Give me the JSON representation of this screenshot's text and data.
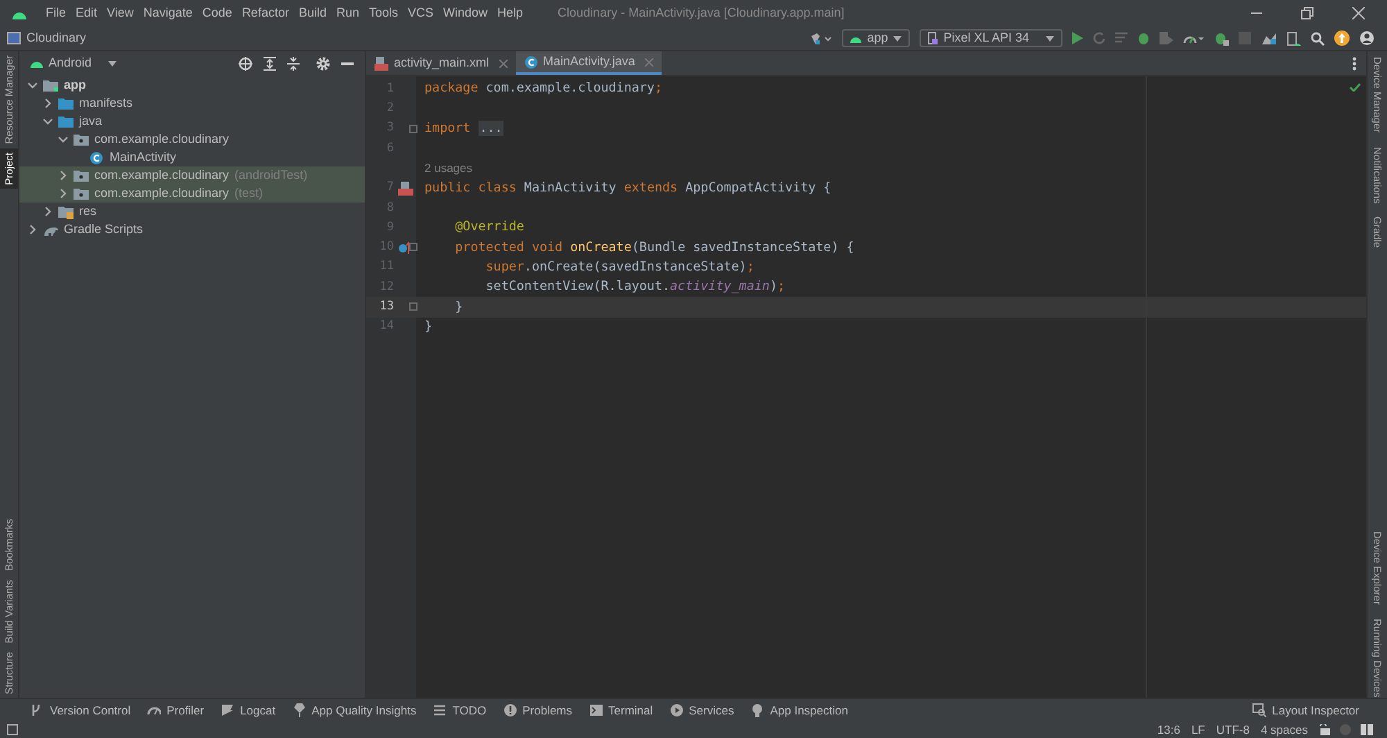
{
  "menu": [
    "File",
    "Edit",
    "View",
    "Navigate",
    "Code",
    "Refactor",
    "Build",
    "Run",
    "Tools",
    "VCS",
    "Window",
    "Help"
  ],
  "window": {
    "title": "Cloudinary - MainActivity.java [Cloudinary.app.main]"
  },
  "breadcrumb": "Cloudinary",
  "run_config": "app",
  "device": "Pixel XL API 34",
  "left_tabs": [
    {
      "label": "Resource Manager",
      "selected": false
    },
    {
      "label": "Project",
      "selected": true
    },
    {
      "label": "Bookmarks",
      "selected": false
    },
    {
      "label": "Build Variants",
      "selected": false
    },
    {
      "label": "Structure",
      "selected": false
    }
  ],
  "right_tabs": [
    "Device Manager",
    "Notifications",
    "Gradle",
    "Device Explorer",
    "Running Devices"
  ],
  "project_view": "Android",
  "tree": [
    {
      "label": "app",
      "kind": "module",
      "expanded": true,
      "highlighted": false,
      "children": [
        {
          "label": "manifests",
          "kind": "folder",
          "expanded": false,
          "highlighted": false
        },
        {
          "label": "java",
          "kind": "folder",
          "expanded": true,
          "highlighted": false,
          "children": [
            {
              "label": "com.example.cloudinary",
              "kind": "package",
              "expanded": true,
              "highlighted": false,
              "children": [
                {
                  "label": "MainActivity",
                  "kind": "class",
                  "highlighted": false
                }
              ]
            },
            {
              "label": "com.example.cloudinary",
              "suffix": "(androidTest)",
              "kind": "package",
              "expanded": false,
              "highlighted": true
            },
            {
              "label": "com.example.cloudinary",
              "suffix": "(test)",
              "kind": "package",
              "expanded": false,
              "highlighted": true
            }
          ]
        },
        {
          "label": "res",
          "kind": "resfolder",
          "expanded": false,
          "highlighted": false
        }
      ]
    },
    {
      "label": "Gradle Scripts",
      "kind": "gradle",
      "expanded": false,
      "highlighted": false
    }
  ],
  "editor_tabs": [
    {
      "label": "activity_main.xml",
      "kind": "xml",
      "selected": false
    },
    {
      "label": "MainActivity.java",
      "kind": "java",
      "selected": true
    }
  ],
  "code": [
    {
      "kind": "line",
      "number": "1",
      "current": false,
      "fold": false,
      "tokens": [
        {
          "t": "package",
          "color": "#cc7832"
        },
        {
          "t": " com.example.cloudinary",
          "color": "#a9b7c6"
        },
        {
          "t": ";",
          "color": "#cc7832"
        }
      ]
    },
    {
      "kind": "line",
      "number": "2",
      "current": false,
      "fold": false
    },
    {
      "kind": "line",
      "number": "3",
      "current": false,
      "fold": true,
      "tokens": [
        {
          "t": "import ",
          "color": "#cc7832"
        },
        {
          "t": "...",
          "color": "#a9b7c6",
          "folded": true
        }
      ]
    },
    {
      "kind": "line",
      "number": "6",
      "current": false,
      "fold": false
    },
    {
      "kind": "hint",
      "text": "2 usages"
    },
    {
      "kind": "line",
      "number": "7",
      "current": false,
      "fold": false,
      "gutter": {
        "kind": "layout"
      },
      "tokens": [
        {
          "t": "public class",
          "color": "#cc7832"
        },
        {
          "t": " MainActivity ",
          "color": "#a9b7c6"
        },
        {
          "t": "extends",
          "color": "#cc7832"
        },
        {
          "t": " AppCompatActivity {",
          "color": "#a9b7c6"
        }
      ]
    },
    {
      "kind": "line",
      "number": "8",
      "current": false,
      "fold": false
    },
    {
      "kind": "line",
      "number": "9",
      "current": false,
      "fold": false,
      "tokens": [
        {
          "t": "    @Override",
          "color": "#bbb529"
        }
      ]
    },
    {
      "kind": "line",
      "number": "10",
      "current": false,
      "fold": true,
      "gutter": {
        "kind": "override"
      },
      "tokens": [
        {
          "t": "    protected void ",
          "color": "#cc7832"
        },
        {
          "t": "onCreate",
          "color": "#ffc66d"
        },
        {
          "t": "(Bundle savedInstanceState) {",
          "color": "#a9b7c6"
        }
      ]
    },
    {
      "kind": "line",
      "number": "11",
      "current": false,
      "fold": false,
      "tokens": [
        {
          "t": "        super",
          "color": "#cc7832"
        },
        {
          "t": ".onCreate(savedInstanceState)",
          "color": "#a9b7c6"
        },
        {
          "t": ";",
          "color": "#cc7832"
        }
      ]
    },
    {
      "kind": "line",
      "number": "12",
      "current": false,
      "fold": false,
      "tokens": [
        {
          "t": "        setContentView(R.layout.",
          "color": "#a9b7c6"
        },
        {
          "t": "activity_main",
          "color": "#9876aa",
          "italic": true
        },
        {
          "t": ")",
          "color": "#a9b7c6"
        },
        {
          "t": ";",
          "color": "#cc7832"
        }
      ]
    },
    {
      "kind": "line",
      "number": "13",
      "current": true,
      "fold": true,
      "tokens": [
        {
          "t": "    }",
          "color": "#a9b7c6"
        }
      ]
    },
    {
      "kind": "line",
      "number": "14",
      "current": false,
      "fold": false,
      "tokens": [
        {
          "t": "}",
          "color": "#a9b7c6"
        }
      ]
    }
  ],
  "tool_windows": [
    {
      "label": "Version Control",
      "kind": "vcs"
    },
    {
      "label": "Profiler",
      "kind": "gauge"
    },
    {
      "label": "Logcat",
      "kind": "logcat"
    },
    {
      "label": "App Quality Insights",
      "kind": "gem"
    },
    {
      "label": "TODO",
      "kind": "list"
    },
    {
      "label": "Problems",
      "kind": "alert"
    },
    {
      "label": "Terminal",
      "kind": "terminal"
    },
    {
      "label": "Services",
      "kind": "play"
    },
    {
      "label": "App Inspection",
      "kind": "bulb"
    }
  ],
  "right_tool": "Layout Inspector",
  "status_bar": [
    "13:6",
    "LF",
    "UTF-8",
    "4 spaces"
  ]
}
